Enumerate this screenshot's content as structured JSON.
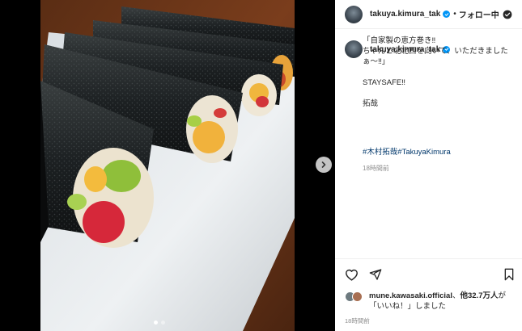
{
  "account": {
    "username": "takuya.kimura_tak",
    "separator": "•",
    "follow_label": "フォロー中"
  },
  "caption": {
    "text": "「自家製の恵方巻き‼︎\nちゃんと北北西を向いて、いただきましたぁ〜‼︎」\n\nSTAYSAFE‼︎\n\n拓哉",
    "hashtags": "#木村拓哉#TakuyaKimura",
    "time": "18時間前"
  },
  "likes": {
    "first_user": "mune.kawasaki.official",
    "connector": "、",
    "others": "他32.7万人",
    "suffix_1": "が",
    "suffix_2": "「いいね！」しました"
  },
  "post_time": "18時間前",
  "carousel": {
    "slides": 2,
    "current": 1
  },
  "colors": {
    "verified": "#0095f6",
    "hashtag": "#00376b",
    "muted": "#8e8e8e",
    "text": "#262626",
    "photo_bg": "#000000"
  },
  "icons": [
    "verified-badge-icon",
    "following-check-icon",
    "heart-icon",
    "share-icon",
    "bookmark-icon",
    "chevron-right-icon"
  ]
}
